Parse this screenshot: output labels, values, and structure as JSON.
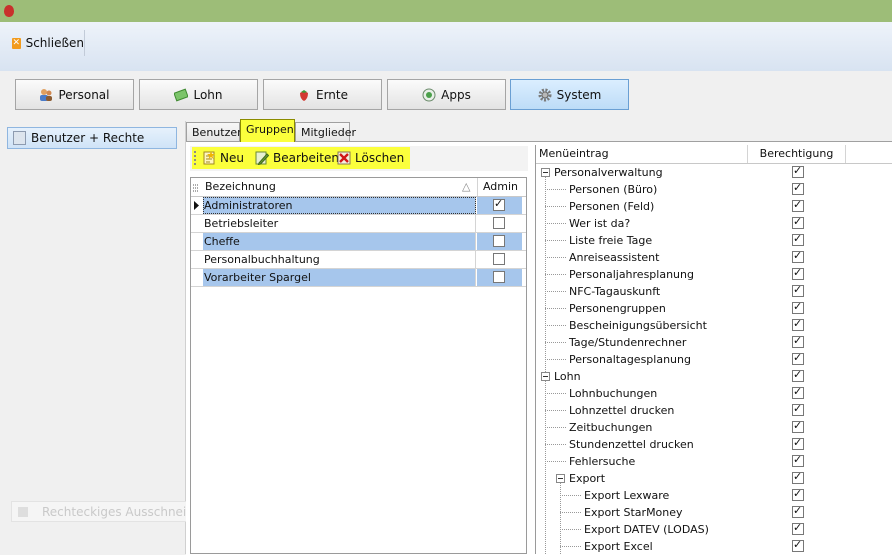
{
  "ribbon": {
    "close_label": "Schließen"
  },
  "modules": [
    {
      "label": "Personal",
      "icon": "people-icon"
    },
    {
      "label": "Lohn",
      "icon": "money-icon"
    },
    {
      "label": "Ernte",
      "icon": "strawberry-icon"
    },
    {
      "label": "Apps",
      "icon": "apps-icon"
    },
    {
      "label": "System",
      "icon": "gear-icon",
      "active": true
    }
  ],
  "sidebar": {
    "item_label": "Benutzer  + Rechte"
  },
  "ghost_label": "Rechteckiges Ausschneiden",
  "tabs": [
    "Benutzer",
    "Gruppen",
    "Mitglieder"
  ],
  "active_tab": "Gruppen",
  "toolbar": {
    "new_label": "Neu",
    "edit_label": "Bearbeiten",
    "delete_label": "Löschen"
  },
  "groups_grid": {
    "columns": [
      "Bezeichnung",
      "Admin"
    ],
    "sort_indicator": "△",
    "rows": [
      {
        "name": "Administratoren",
        "admin": true
      },
      {
        "name": "Betriebsleiter",
        "admin": false
      },
      {
        "name": "Cheffe",
        "admin": false
      },
      {
        "name": "Personalbuchhaltung",
        "admin": false
      },
      {
        "name": "Vorarbeiter Spargel",
        "admin": false
      }
    ]
  },
  "permissions": {
    "columns": [
      "Menüeintrag",
      "Berechtigung"
    ],
    "items": [
      {
        "label": "Personalverwaltung",
        "level": 0,
        "expander": true,
        "checked": true
      },
      {
        "label": "Personen (Büro)",
        "level": 1,
        "checked": true
      },
      {
        "label": "Personen (Feld)",
        "level": 1,
        "checked": true
      },
      {
        "label": "Wer ist da?",
        "level": 1,
        "checked": true
      },
      {
        "label": "Liste freie Tage",
        "level": 1,
        "checked": true
      },
      {
        "label": "Anreiseassistent",
        "level": 1,
        "checked": true
      },
      {
        "label": "Personaljahresplanung",
        "level": 1,
        "checked": true
      },
      {
        "label": "NFC-Tagauskunft",
        "level": 1,
        "checked": true
      },
      {
        "label": "Personengruppen",
        "level": 1,
        "checked": true
      },
      {
        "label": "Bescheinigungsübersicht",
        "level": 1,
        "checked": true
      },
      {
        "label": "Tage/Stundenrechner",
        "level": 1,
        "checked": true
      },
      {
        "label": "Personaltagesplanung",
        "level": 1,
        "checked": true
      },
      {
        "label": "Lohn",
        "level": 0,
        "expander": true,
        "checked": true
      },
      {
        "label": "Lohnbuchungen",
        "level": 1,
        "checked": true
      },
      {
        "label": "Lohnzettel drucken",
        "level": 1,
        "checked": true
      },
      {
        "label": "Zeitbuchungen",
        "level": 1,
        "checked": true
      },
      {
        "label": "Stundenzettel drucken",
        "level": 1,
        "checked": true
      },
      {
        "label": "Fehlersuche",
        "level": 1,
        "checked": true
      },
      {
        "label": "Export",
        "level": 1,
        "expander": true,
        "checked": true
      },
      {
        "label": "Export Lexware",
        "level": 2,
        "checked": true
      },
      {
        "label": "Export StarMoney",
        "level": 2,
        "checked": true
      },
      {
        "label": "Export DATEV (LODAS)",
        "level": 2,
        "checked": true
      },
      {
        "label": "Export Excel",
        "level": 2,
        "checked": true
      }
    ]
  },
  "colors": {
    "highlight": "#fbff3c",
    "selection": "#a6c6ec",
    "titlebar": "#9dbd78"
  }
}
